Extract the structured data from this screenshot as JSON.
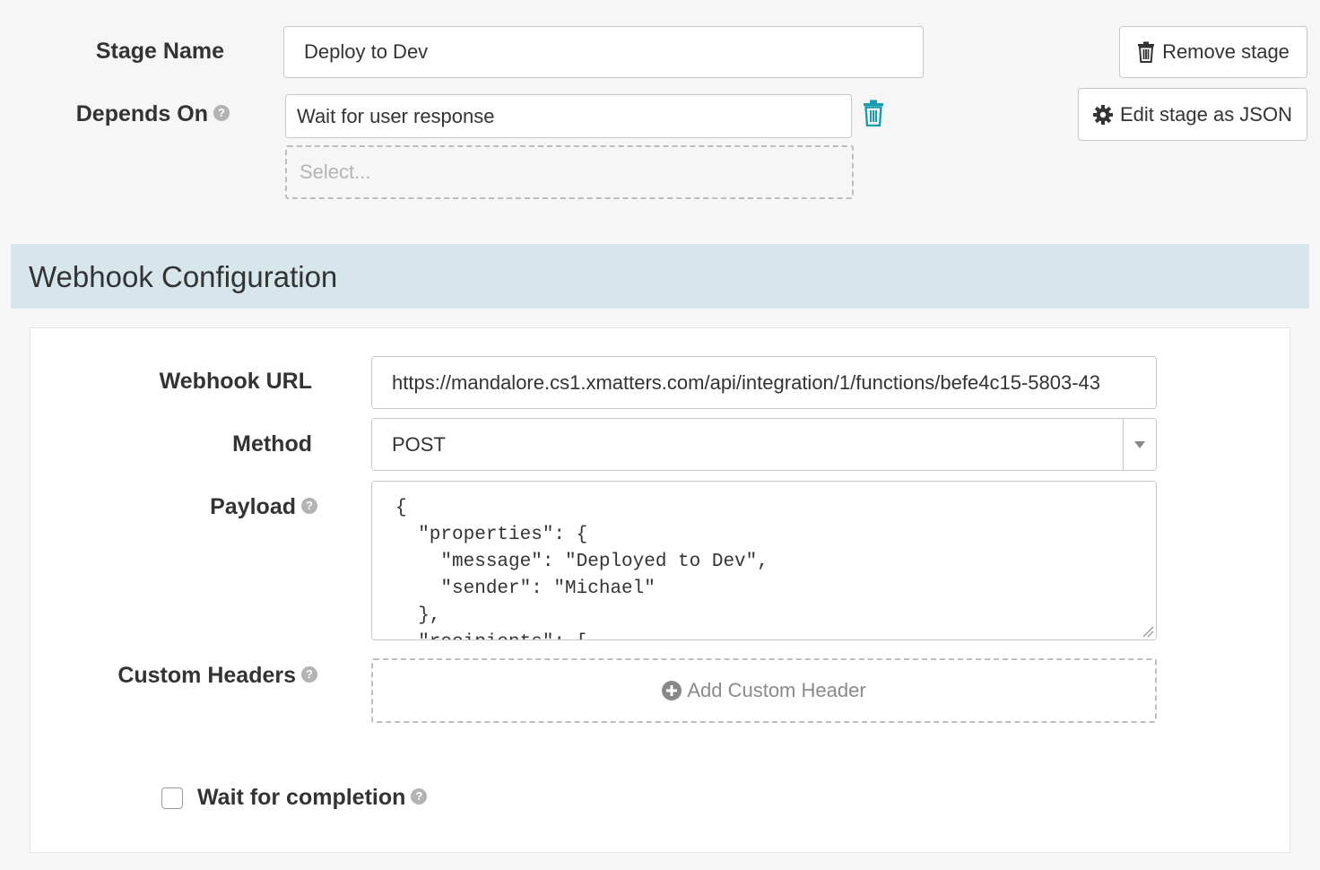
{
  "stage": {
    "name_label": "Stage Name",
    "name_value": "Deploy to Dev",
    "depends_label": "Depends On",
    "depends_value": "Wait for user response",
    "depends_placeholder": "Select..."
  },
  "actions": {
    "remove_label": "Remove stage",
    "edit_json_label": "Edit stage as JSON"
  },
  "section": {
    "title": "Webhook Configuration"
  },
  "webhook": {
    "url_label": "Webhook URL",
    "url_value": "https://mandalore.cs1.xmatters.com/api/integration/1/functions/befe4c15-5803-43",
    "method_label": "Method",
    "method_value": "POST",
    "payload_label": "Payload",
    "payload_lines": [
      "{",
      "  \"properties\": {",
      "    \"message\": \"Deployed to Dev\",",
      "    \"sender\": \"Michael\"",
      "  },",
      "  \"recipients\": ["
    ],
    "headers_label": "Custom Headers",
    "add_header_label": "Add Custom Header",
    "wait_label": "Wait for completion"
  },
  "icons": {
    "help": "question-circle-icon",
    "trash": "trash-icon",
    "gear": "gear-icon",
    "plus": "plus-circle-icon",
    "caret": "caret-down-icon"
  },
  "colors": {
    "accent": "#1a9cb0",
    "header_bg": "#d6e6ea",
    "page_bg": "#f6f6f6"
  }
}
